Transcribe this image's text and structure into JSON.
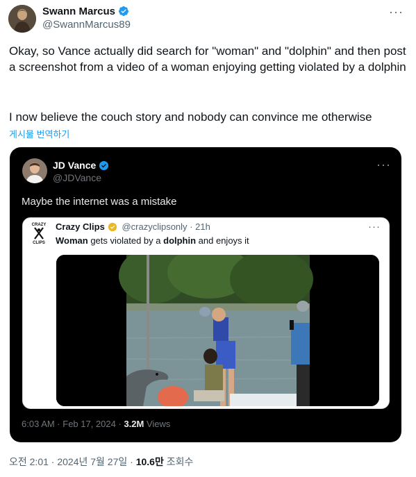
{
  "outer_tweet": {
    "author_name": "Swann Marcus",
    "author_handle": "@SwannMarcus89",
    "text_p1": "Okay, so Vance actually did search for \"woman\" and \"dolphin\" and then post a screenshot from a video of a woman enjoying getting violated by a dolphin",
    "text_p2": "I now believe the couch story and nobody can convince me otherwise",
    "translate_label": "게시물 번역하기",
    "more_label": "···",
    "footer_time": "오전 2:01 · 2024년 7월 27일",
    "footer_sep": "·",
    "footer_views": "10.6만",
    "footer_views_label": "조회수"
  },
  "quoted_tweet": {
    "author_name": "JD Vance",
    "author_handle": "@JDVance",
    "text": "Maybe the internet was a mistake",
    "more_label": "···",
    "footer_time": "6:03 AM · Feb 17, 2024 ·",
    "footer_views": "3.2M",
    "footer_views_label": "Views"
  },
  "inner_tweet": {
    "author_name": "Crazy Clips",
    "author_handle": "@crazyclipsonly",
    "time": "· 21h",
    "more_label": "···",
    "text_1": "Woman",
    "text_2": " gets violated by a ",
    "text_3": "dolphin",
    "text_4": " and enjoys it",
    "logo_text_top": "CRAZY",
    "logo_text_bottom": "CLIPS"
  },
  "colors": {
    "verified_blue": "#1d9bf0",
    "verified_gold": "#e8b829",
    "link_blue": "#1d9bf0",
    "muted": "#536471"
  }
}
